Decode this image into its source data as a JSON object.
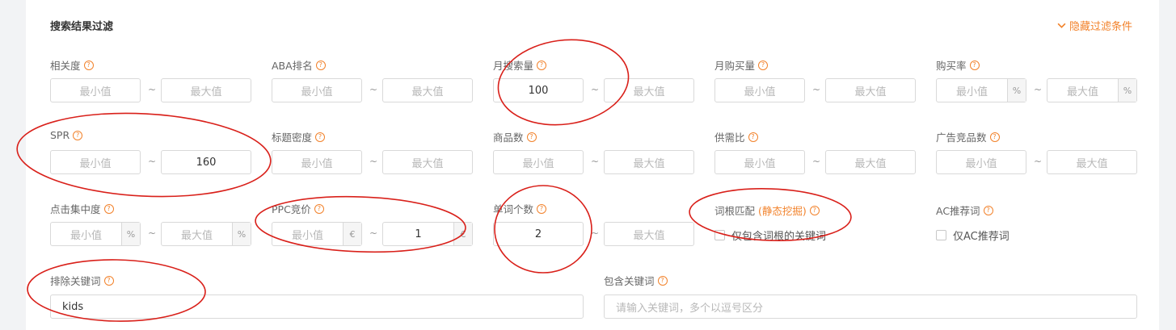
{
  "header": {
    "title": "搜索结果过滤",
    "collapse_label": "隐藏过滤条件"
  },
  "labels": {
    "relevance": "相关度",
    "aba_rank": "ABA排名",
    "monthly_search": "月搜索量",
    "monthly_purchase": "月购买量",
    "purchase_rate": "购买率",
    "spr": "SPR",
    "title_density": "标题密度",
    "product_count": "商品数",
    "supply_demand": "供需比",
    "ad_products": "广告竞品数",
    "click_concentration": "点击集中度",
    "ppc_bid": "PPC竞价",
    "word_count": "单词个数",
    "root_match": "词根匹配",
    "root_match_note": "(静态挖掘)",
    "ac_recommend": "AC推荐词",
    "exclude_keywords": "排除关键词",
    "include_keywords": "包含关键词"
  },
  "placeholders": {
    "min": "最小值",
    "max": "最大值",
    "include_keywords": "请输入关键词，多个以逗号区分"
  },
  "values": {
    "monthly_search_min": "100",
    "spr_max": "160",
    "ppc_bid_max": "1",
    "word_count_min": "2",
    "exclude_keywords": "kids"
  },
  "units": {
    "percent": "%",
    "euro": "€"
  },
  "checkboxes": {
    "root_only": "仅包含词根的关键词",
    "ac_only": "仅AC推荐词"
  },
  "separator": "~",
  "help_glyph": "?",
  "colors": {
    "accent": "#f2822b",
    "annotation": "#d9201a"
  }
}
